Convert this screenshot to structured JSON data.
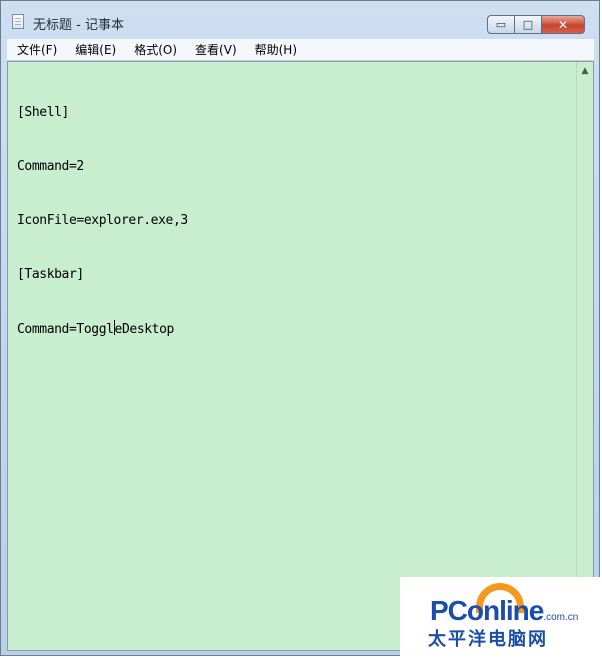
{
  "window": {
    "title": "无标题 - 记事本",
    "icon": "notepad-icon",
    "caption_buttons": {
      "minimize_glyph": "▭",
      "maximize_glyph": "□",
      "close_glyph": "✕"
    }
  },
  "menubar": {
    "items": [
      {
        "label": "文件(F)"
      },
      {
        "label": "编辑(E)"
      },
      {
        "label": "格式(O)"
      },
      {
        "label": "查看(V)"
      },
      {
        "label": "帮助(H)"
      }
    ]
  },
  "editor": {
    "background": "#c8edcf",
    "lines": [
      "[Shell]",
      "Command=2",
      "IconFile=explorer.exe,3",
      "[Taskbar]"
    ],
    "caret_line_before": "Command=Toggl",
    "caret_line_after": "eDesktop",
    "scroll_up_glyph": "▲"
  },
  "watermark": {
    "brand": "PConline",
    "suffix": ".com.cn",
    "chinese": "太平洋电脑网",
    "brand_color": "#1a4ea8",
    "accent_color": "#f39a1e"
  }
}
